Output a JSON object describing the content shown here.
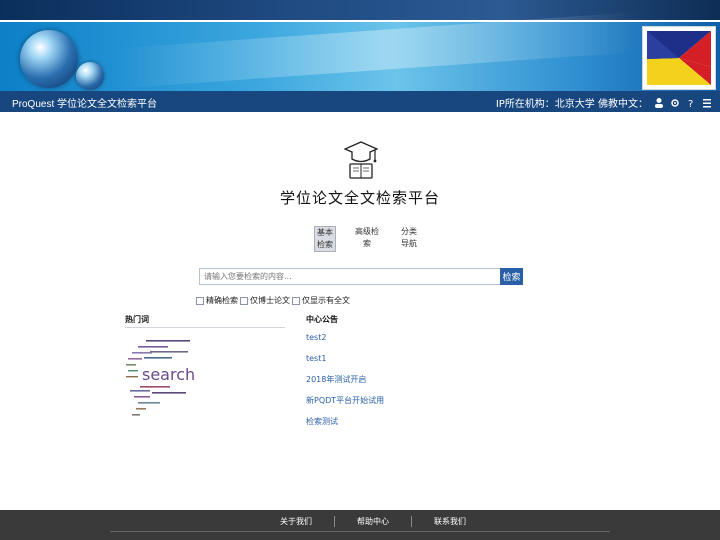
{
  "header": {
    "platform_title": "ProQuest 学位论文全文检索平台",
    "user_info": "IP所在机构：北京大学 佛教中文：",
    "colors": {
      "nav_bar": "#18477f",
      "banner": "#3aa6de",
      "search_button": "#2a5fa8",
      "footer": "#3a3a3a"
    },
    "icons": [
      "user-icon",
      "settings-icon",
      "help-icon",
      "menu-icon"
    ]
  },
  "main": {
    "site_title": "学位论文全文检索平台",
    "tabs": [
      {
        "label": "基本检索",
        "active": true
      },
      {
        "label": "高级检索",
        "active": false
      },
      {
        "label": "分类导航",
        "active": false
      }
    ],
    "search": {
      "placeholder": "请输入您要检索的内容...",
      "button_label": "检索"
    },
    "options": {
      "opt1": "精确检索",
      "opt2": "仅博士论文",
      "opt3": "仅显示有全文"
    },
    "hot_words": {
      "heading": "热门词",
      "cloud_main": "search"
    },
    "notices": {
      "heading": "中心公告",
      "items": [
        "test2",
        "test1",
        "2018年测试开启",
        "新PQDT平台开始试用",
        "检索测试"
      ]
    }
  },
  "footer": {
    "links": [
      "关于我们",
      "帮助中心",
      "联系我们"
    ]
  }
}
